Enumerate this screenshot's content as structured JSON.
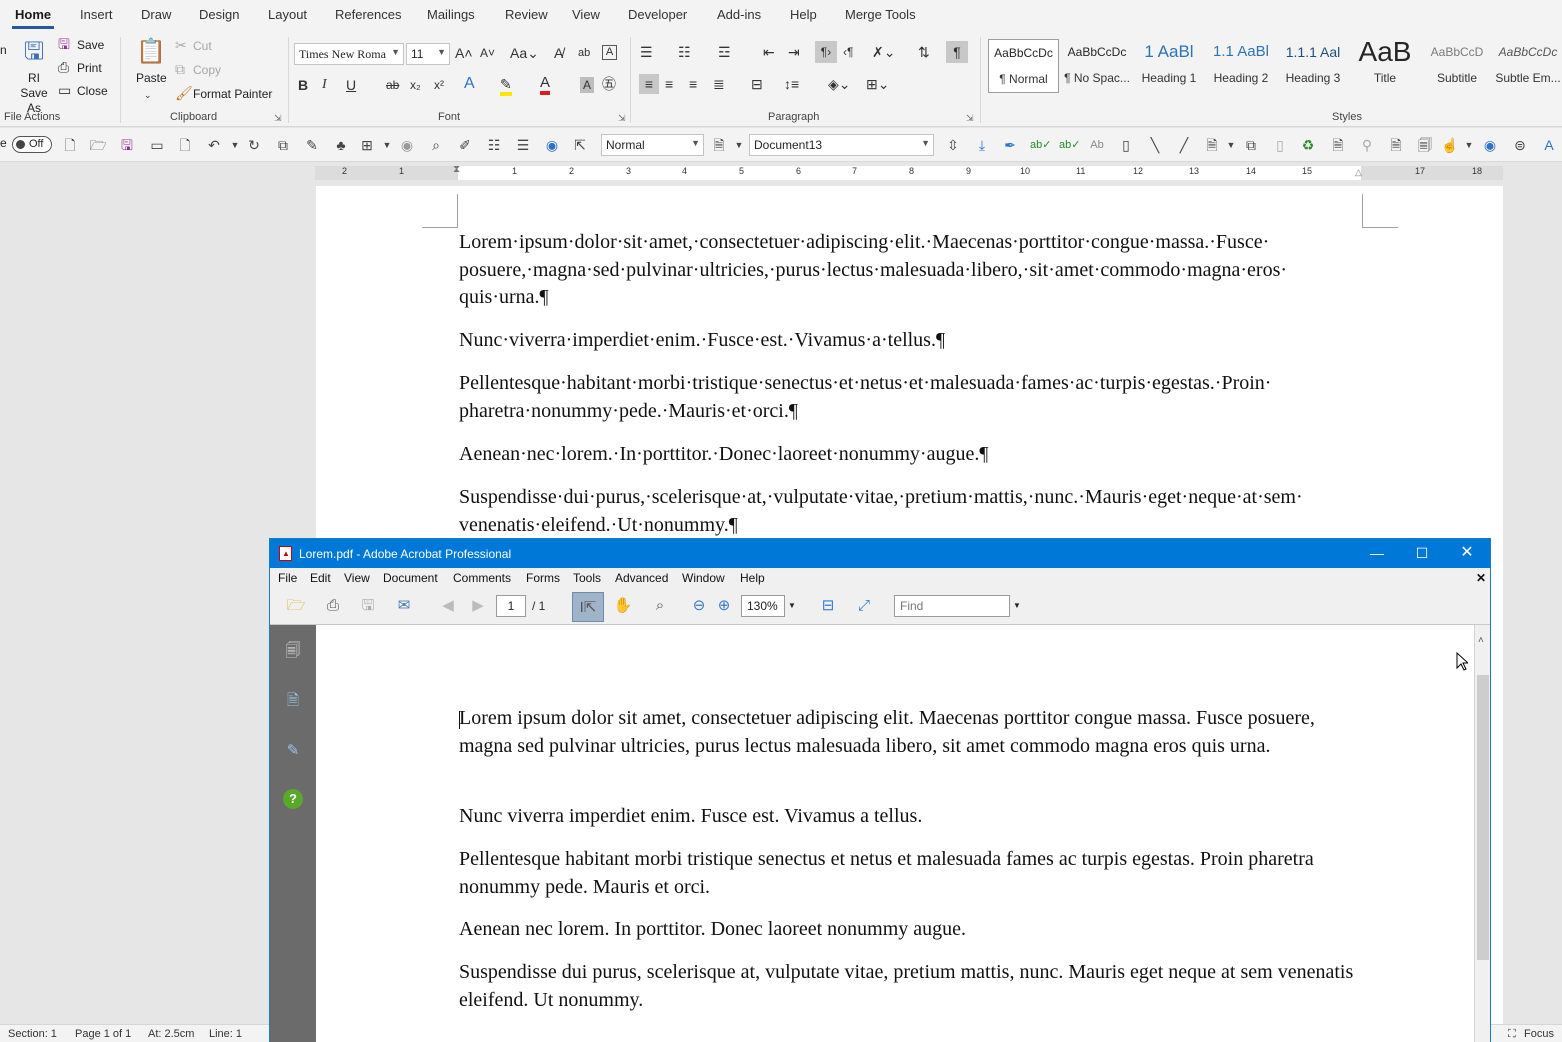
{
  "word": {
    "tabs": [
      "Home",
      "Insert",
      "Draw",
      "Design",
      "Layout",
      "References",
      "Mailings",
      "Review",
      "View",
      "Developer",
      "Add-ins",
      "Help",
      "Merge Tools"
    ],
    "file_actions": {
      "label": "File Actions",
      "save_as": "RI Save As",
      "save": "Save",
      "print": "Print",
      "close": "Close",
      "partial": "n"
    },
    "clipboard": {
      "label": "Clipboard",
      "paste": "Paste",
      "cut": "Cut",
      "copy": "Copy",
      "format_painter": "Format Painter"
    },
    "font": {
      "label": "Font",
      "name": "Times New Roma",
      "size": "11"
    },
    "paragraph": {
      "label": "Paragraph"
    },
    "styles": {
      "label": "Styles",
      "items": [
        {
          "preview": "AaBbCcDc",
          "name": "¶ Normal"
        },
        {
          "preview": "AaBbCcDc",
          "name": "¶ No Spac..."
        },
        {
          "preview": "1  AaBl",
          "name": "Heading 1"
        },
        {
          "preview": "1.1  AaBl",
          "name": "Heading 2"
        },
        {
          "preview": "1.1.1  Aal",
          "name": "Heading 3"
        },
        {
          "preview": "AaB",
          "name": "Title"
        },
        {
          "preview": "AaBbCcD",
          "name": "Subtitle"
        },
        {
          "preview": "AaBbCcDc",
          "name": "Subtle Em..."
        }
      ]
    },
    "qat": {
      "toggle": "Off",
      "style_combo": "Normal",
      "doc_combo": "Document13"
    },
    "ruler_numbers": [
      "2",
      "1",
      "1",
      "1",
      "2",
      "3",
      "4",
      "5",
      "6",
      "7",
      "8",
      "9",
      "10",
      "11",
      "12",
      "13",
      "14",
      "15",
      "16",
      "17",
      "18"
    ],
    "paragraphs": [
      "Lorem·ipsum·dolor·sit·amet,·consectetuer·adipiscing·elit.·Maecenas·porttitor·congue·massa.·Fusce· posuere,·magna·sed·pulvinar·ultricies,·purus·lectus·malesuada·libero,·sit·amet·commodo·magna·eros· quis·urna.¶",
      "Nunc·viverra·imperdiet·enim.·Fusce·est.·Vivamus·a·tellus.¶",
      "Pellentesque·habitant·morbi·tristique·senectus·et·netus·et·malesuada·fames·ac·turpis·egestas.·Proin· pharetra·nonummy·pede.·Mauris·et·orci.¶",
      "Aenean·nec·lorem.·In·porttitor.·Donec·laoreet·nonummy·augue.¶",
      "Suspendisse·dui·purus,·scelerisque·at,·vulputate·vitae,·pretium·mattis,·nunc.·Mauris·eget·neque·at·sem· venenatis·eleifend.·Ut·nonummy.¶"
    ],
    "status": {
      "section": "Section: 1",
      "page": "Page 1 of 1",
      "at": "At: 2.5cm",
      "line": "Line: 1",
      "focus": "Focus"
    }
  },
  "acrobat": {
    "title": "Lorem.pdf - Adobe Acrobat Professional",
    "menus": [
      "File",
      "Edit",
      "View",
      "Document",
      "Comments",
      "Forms",
      "Tools",
      "Advanced",
      "Window",
      "Help"
    ],
    "page_current": "1",
    "page_total": "/ 1",
    "zoom": "130%",
    "find_placeholder": "Find",
    "paragraphs": [
      "Lorem ipsum dolor sit amet, consectetuer adipiscing elit. Maecenas porttitor congue massa. Fusce posuere, magna sed pulvinar ultricies, purus lectus malesuada libero, sit amet commodo magna eros quis urna.",
      "Nunc viverra imperdiet enim. Fusce est. Vivamus a tellus.",
      "Pellentesque habitant morbi tristique senectus et netus et malesuada fames ac turpis egestas. Proin pharetra nonummy pede. Mauris et orci.",
      "Aenean nec lorem. In porttitor. Donec laoreet nonummy augue.",
      "Suspendisse dui purus, scelerisque at, vulputate vitae, pretium mattis, nunc. Mauris eget neque at sem venenatis eleifend. Ut nonummy."
    ]
  },
  "colors": {
    "accent": "#2b579a",
    "acrobat_title": "#0078d7"
  }
}
